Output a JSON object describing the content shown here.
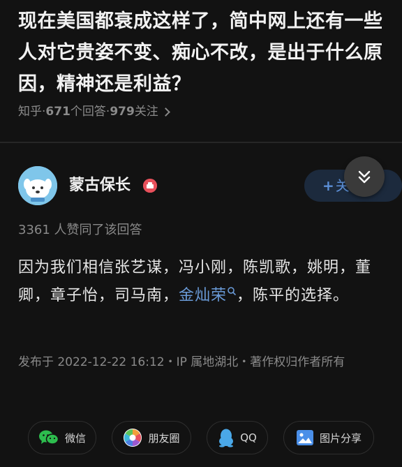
{
  "question": {
    "title": "现在美国都衰成这样了，简中网上还有一些人对它贵姿不变、痴心不改，是出于什么原因，精神还是利益？",
    "source": "知乎",
    "answers_count": "671",
    "answers_label": "个回答",
    "followers_count": "979",
    "followers_label": "关注"
  },
  "author": {
    "name": "蒙古保长",
    "follow_plus": "+",
    "follow_label": "关注"
  },
  "answer": {
    "votes_text": "3361 人赞同了该回答",
    "text_before_link": "因为我们相信张艺谋，冯小刚，陈凯歌，姚明，董卿，章子怡，司马南，",
    "link_text": "金灿荣",
    "text_after_link": "，陈平的选择。",
    "meta_text": "发布于 2022-12-22 16:12・IP 属地湖北・著作权归作者所有"
  },
  "share": {
    "wechat_label": "微信",
    "moments_label": "朋友圈",
    "qq_label": "QQ",
    "image_share_label": "图片分享"
  },
  "colors": {
    "background": "#121212",
    "link": "#6a9bd8",
    "follow_text": "#5c8fd6",
    "wechat_green": "#2dbd4e",
    "qq_blue": "#4aa8e8"
  }
}
